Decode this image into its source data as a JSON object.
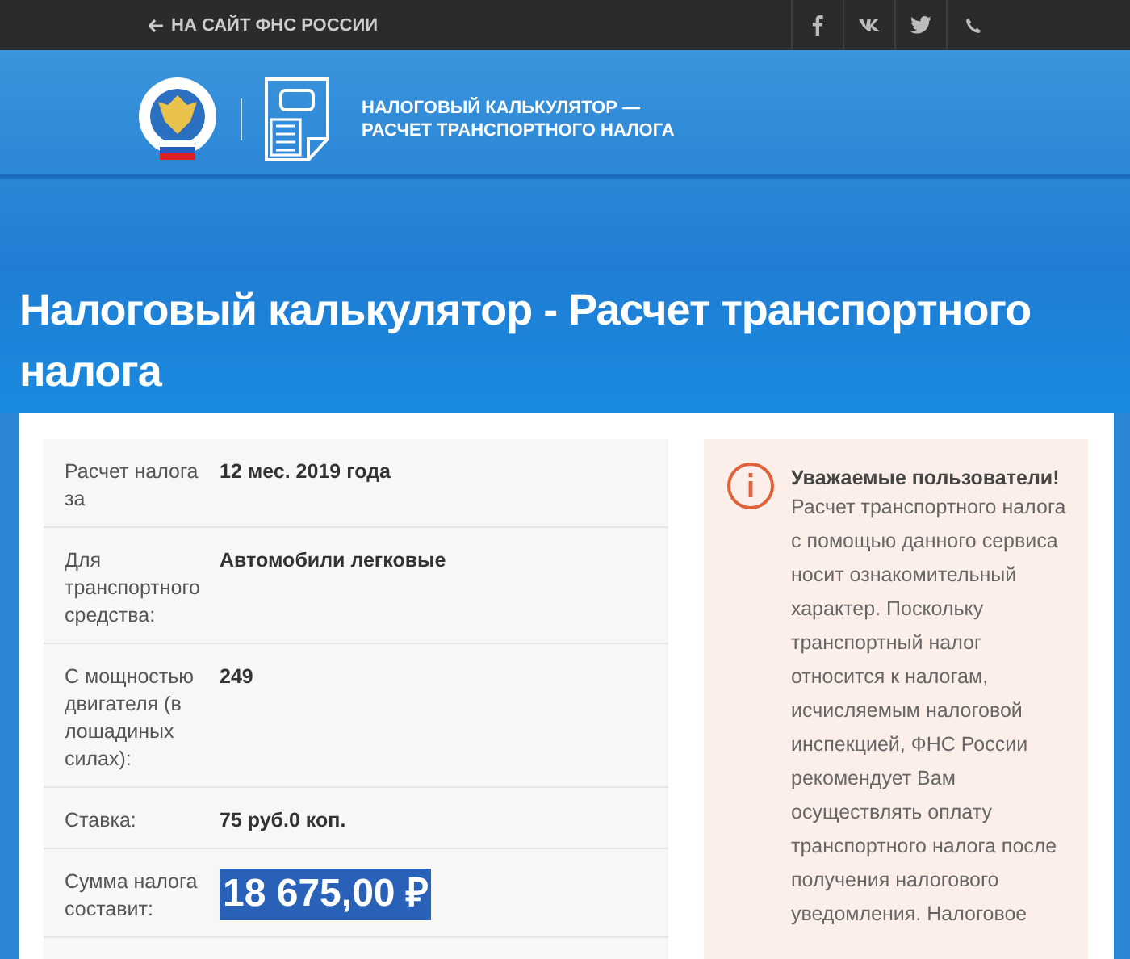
{
  "top_bar": {
    "back_link": "НА САЙТ ФНС РОССИИ"
  },
  "header": {
    "title_lines": [
      "НАЛОГОВЫЙ КАЛЬКУЛЯТОР —",
      "РАСЧЕТ ТРАНСПОРТНОГО НАЛОГА"
    ]
  },
  "page_title": "Налоговый калькулятор - Расчет транспортного налога",
  "results": [
    {
      "kind": "plain",
      "label": "Расчет налога за",
      "value": "12 мес. 2019 года"
    },
    {
      "kind": "plain",
      "label": "Для транспортного средства:",
      "value": "Автомобили легковые"
    },
    {
      "kind": "plain",
      "label": "С мощностью двигателя (в лошадиных силах):",
      "value": "249"
    },
    {
      "kind": "plain",
      "label": "Ставка:",
      "value": "75 руб.0 коп."
    },
    {
      "kind": "total",
      "label": "Сумма налога составит:",
      "value": "18 675,00 ₽"
    }
  ],
  "notice": {
    "title": "Уважаемые пользователи!",
    "text": "Расчет транспортного налога с помощью данного сервиса носит ознакомительный характер. Поскольку транспортный налог относится к налогам, исчисляемым налоговой инспекцией, ФНС России рекомендует Вам осуществлять оплату транспортного налога после получения налогового уведомления. Налоговое"
  }
}
